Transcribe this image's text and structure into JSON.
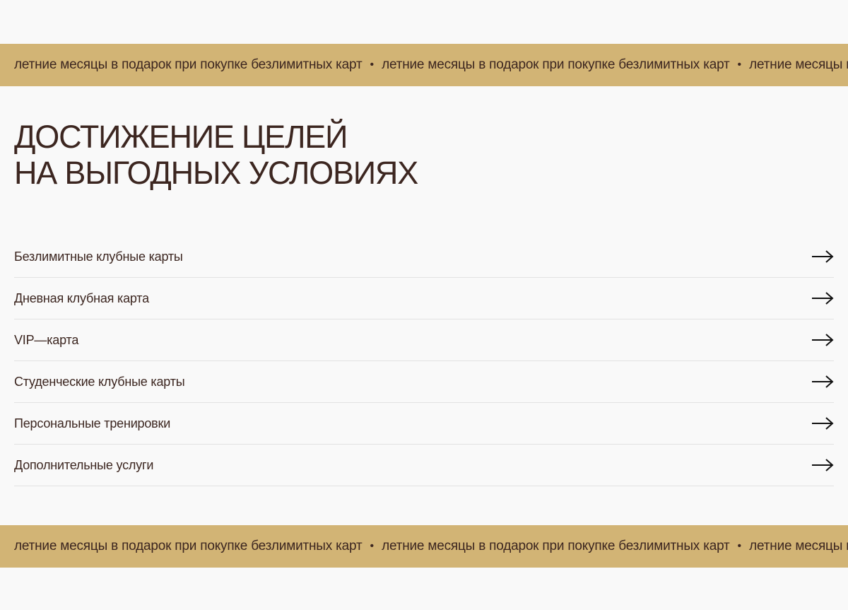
{
  "ticker": {
    "text": "летние месяцы в подарок при покупке безлимитных карт",
    "separator": "•"
  },
  "heading": {
    "line1": "ДОСТИЖЕНИЕ ЦЕЛЕЙ",
    "line2": "НА ВЫГОДНЫХ УСЛОВИЯХ"
  },
  "menu": {
    "items": [
      {
        "label": "Безлимитные клубные карты",
        "icon": "arrow-right-icon"
      },
      {
        "label": "Дневная клубная карта",
        "icon": "arrow-right-icon"
      },
      {
        "label": "VIP—карта",
        "icon": "arrow-right-icon"
      },
      {
        "label": "Студенческие клубные карты",
        "icon": "arrow-right-icon"
      },
      {
        "label": "Персональные тренировки",
        "icon": "arrow-right-icon"
      },
      {
        "label": "Дополнительные услуги",
        "icon": "arrow-right-icon"
      }
    ]
  },
  "colors": {
    "background": "#f9f9f9",
    "ticker_background": "#d2b475",
    "text": "#3c2620",
    "divider": "#e2e2e2"
  }
}
